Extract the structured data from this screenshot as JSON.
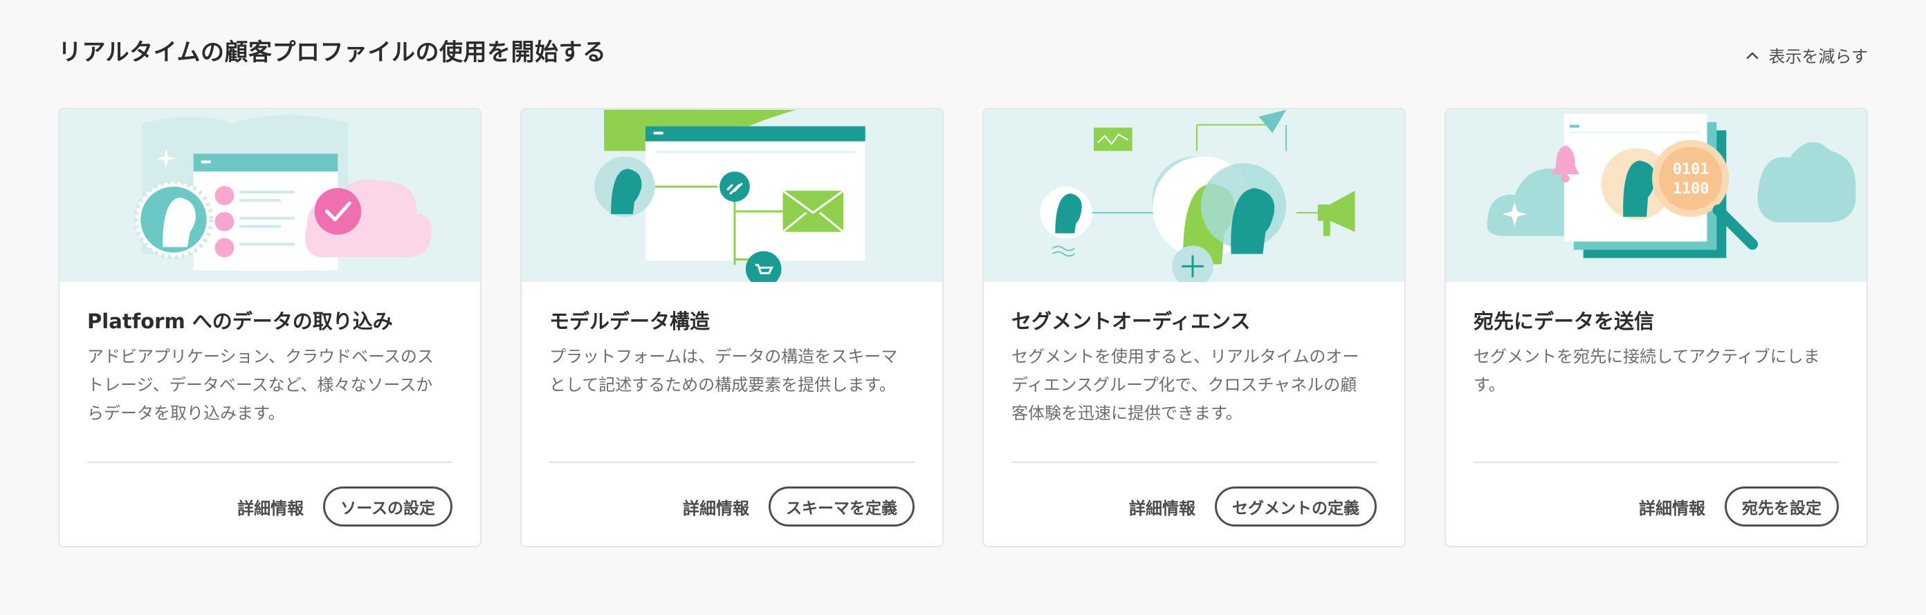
{
  "header": {
    "title": "リアルタイムの顧客プロファイルの使用を開始する",
    "collapse_label": "表示を減らす"
  },
  "cards": [
    {
      "title": "Platform へのデータの取り込み",
      "description": "アドビアプリケーション、クラウドベースのストレージ、データベースなど、様々なソースからデータを取り込みます。",
      "learn_more": "詳細情報",
      "action": "ソースの設定"
    },
    {
      "title": "モデルデータ構造",
      "description": "プラットフォームは、データの構造をスキーマとして記述するための構成要素を提供します。",
      "learn_more": "詳細情報",
      "action": "スキーマを定義"
    },
    {
      "title": "セグメントオーディエンス",
      "description": "セグメントを使用すると、リアルタイムのオーディエンスグループ化で、クロスチャネルの顧客体験を迅速に提供できます。",
      "learn_more": "詳細情報",
      "action": "セグメントの定義"
    },
    {
      "title": "宛先にデータを送信",
      "description": "セグメントを宛先に接続してアクティブにします。",
      "learn_more": "詳細情報",
      "action": "宛先を設定"
    }
  ],
  "illustration_text": {
    "binary": "0101 1100"
  },
  "colors": {
    "teal": "#1a9c95",
    "light_teal": "#6cc8c5",
    "green": "#8fd14f",
    "pink": "#f06fb0",
    "background": "#e3f2f2"
  }
}
